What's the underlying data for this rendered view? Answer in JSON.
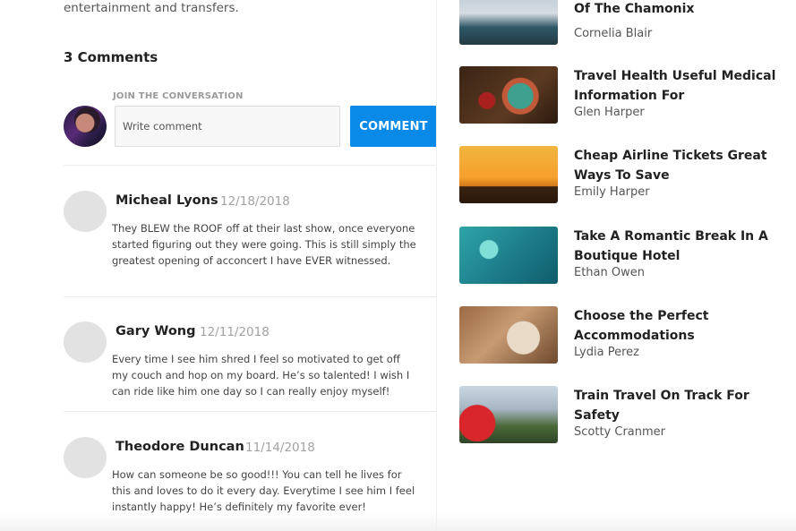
{
  "article": {
    "intro_tail": "entertainment and transfers."
  },
  "comments_section": {
    "heading": "3 Comments",
    "join_label": "JOIN THE CONVERSATION",
    "input_placeholder": "Write comment",
    "input_value": "",
    "submit_label": "COMMENT",
    "accent_color": "#0a8ae8"
  },
  "comments": [
    {
      "name": "Micheal Lyons",
      "date": "12/18/2018",
      "text": "They BLEW the ROOF off at their last show, once everyone started figuring out they were going. This is still simply the greatest opening of acconcert I have EVER witnessed."
    },
    {
      "name": "Gary Wong",
      "date": "12/11/2018",
      "text": "Every time I see him shred I feel so motivated to get off my couch and hop on my board. He’s so talented! I wish I can ride like him one day so I can really enjoy myself!"
    },
    {
      "name": "Theodore Duncan",
      "date": "11/14/2018",
      "text": "How can someone be so good!!! You can tell he lives for this and loves to do it every day. Everytime I see him I feel instantly happy! He’s definitely my favorite ever!"
    }
  ],
  "sidebar": {
    "posts": [
      {
        "title": "Les Houches The Hidden Gem Of The Chamonix",
        "author": "Cornelia Blair",
        "thumbnail": "restaurant-mountain-view-image"
      },
      {
        "title": "Travel Health Useful Medical Information For",
        "author": "Glen Harper",
        "thumbnail": "smoothie-bowl-image"
      },
      {
        "title": "Cheap Airline Tickets Great Ways To Save",
        "author": "Emily Harper",
        "thumbnail": "sunset-balloons-temples-image"
      },
      {
        "title": "Take A Romantic Break In A Boutique Hotel",
        "author": "Ethan Owen",
        "thumbnail": "overwater-villas-aerial-image"
      },
      {
        "title": "Choose the Perfect Accommodations",
        "author": "Lydia Perez",
        "thumbnail": "hotel-armchair-image"
      },
      {
        "title": "Train Travel On Track For Safety",
        "author": "Scotty Cranmer",
        "thumbnail": "red-train-viaduct-image"
      }
    ]
  }
}
